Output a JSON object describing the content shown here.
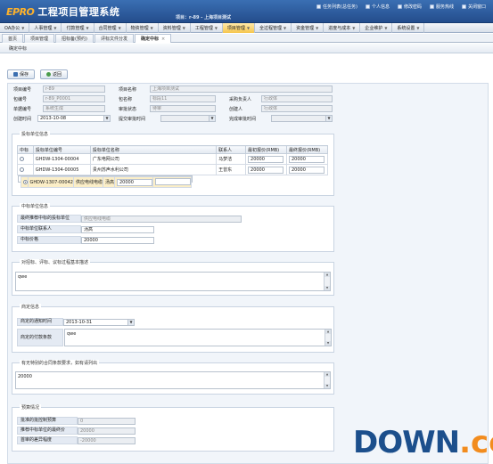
{
  "header": {
    "brand": "EPRO",
    "title": "工程项目管理系统",
    "project": "项目：r-89 - 上海项目测试",
    "links": [
      "任务列表(总任务)",
      "个人信息",
      "修改密码",
      "服务热线",
      "关闭窗口"
    ]
  },
  "menu": [
    {
      "label": "OA办公",
      "dd": true
    },
    {
      "label": "人事管理",
      "dd": true
    },
    {
      "label": "付款管理",
      "dd": true
    },
    {
      "label": "合同管理",
      "dd": true
    },
    {
      "label": "物资管理",
      "dd": true
    },
    {
      "label": "资料管理",
      "dd": true
    },
    {
      "label": "工程管理",
      "dd": true
    },
    {
      "label": "项目管理",
      "dd": true,
      "active": true
    },
    {
      "label": "全过程管理",
      "dd": true
    },
    {
      "label": "资金管理",
      "dd": true
    },
    {
      "label": "进度与成本",
      "dd": true
    },
    {
      "label": "企业维护",
      "dd": true
    },
    {
      "label": "系统设置",
      "dd": true
    }
  ],
  "tabs": [
    {
      "label": "首页"
    },
    {
      "label": "项目管理"
    },
    {
      "label": "招标备(预约)"
    },
    {
      "label": "评标文件分发"
    },
    {
      "label": "确定中标",
      "active": true,
      "closable": true
    }
  ],
  "page_title": "确定中标",
  "toolbar": {
    "save": "保存",
    "back": "返回"
  },
  "basic": {
    "project_no_label": "项目编号",
    "project_no": "r-89",
    "project_name_label": "项目名称",
    "project_name": "上海项目测试",
    "package_no_label": "包编号",
    "package_no": "r-89_P0001",
    "package_name_label": "包名称",
    "package_name": "标段11",
    "purchase_owner_label": "采购负责人",
    "purchase_owner": "行政体",
    "doc_no_label": "单据编号",
    "doc_no": "系统生成",
    "approve_status_label": "审批状态",
    "approve_status": "待审",
    "creator_label": "创建人",
    "creator": "行政体",
    "create_time_label": "创建时间",
    "create_time": "2013-10-08",
    "submit_time_label": "提交审批时间",
    "submit_time": "",
    "finish_time_label": "完成审批时间",
    "finish_time": ""
  },
  "bidders": {
    "title": "投标单位信息",
    "columns": [
      "中标",
      "投标单位编号",
      "投标单位名称",
      "联系人",
      "最初报价(RMB)",
      "最终报价(RMB)"
    ],
    "rows": [
      {
        "selected": false,
        "code": "GHDW-1304-00004",
        "name": "广东电网公司",
        "contact": "马梦洁",
        "first": "20000",
        "final": "20000"
      },
      {
        "selected": false,
        "code": "GHDW-1304-00005",
        "name": "贵州苏声水利公司",
        "contact": "王曾东",
        "first": "20000",
        "final": "20000"
      },
      {
        "selected": true,
        "code": "GHDW-1307-00042",
        "name": "供应电线电缆",
        "contact": "汤高",
        "first": "20000",
        "final": ""
      }
    ]
  },
  "winner": {
    "title": "中标单位信息",
    "final_label": "最终推荐中标的投标单位",
    "final_value": "供应电线电缆",
    "contact_label": "中标单位联系人",
    "contact_value": "汤高",
    "price_label": "中标价格",
    "price_value": "20000"
  },
  "review": {
    "title": "对招标、评标、议标过程基本描述",
    "value": "qwe"
  },
  "confirm": {
    "title": "商定信息",
    "notice_time_label": "商定的通知时间",
    "notice_time": "2013-10-31",
    "payment_label": "商定的付款条款",
    "payment_value": "qwe"
  },
  "other": {
    "title": "有无特别的合同条款要求，如有请列出",
    "value": "20000"
  },
  "budget": {
    "title": "预算情况",
    "control_label": "批准的批控制预算",
    "control_value": "0",
    "bid_label": "推荐中标单位的最终价",
    "bid_value": "20000",
    "diff_label": "首审的差异幅度",
    "diff_value": "-20000"
  },
  "watermark": {
    "main": "DOWN",
    "ext": ".cc"
  },
  "colors": {
    "header": "#2f5f9e",
    "accent": "#f6c64e",
    "brand": "#ffb22b"
  }
}
